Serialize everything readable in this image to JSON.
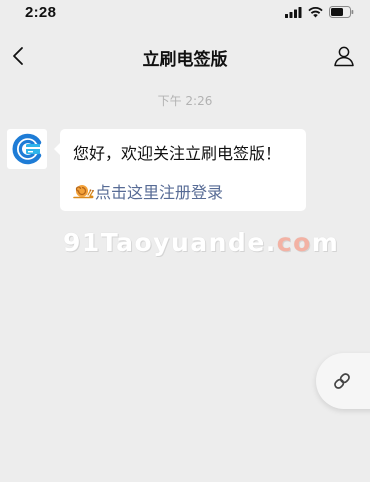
{
  "status_bar": {
    "time": "2:28",
    "icons": [
      "signal-icon",
      "wifi-icon",
      "battery-icon"
    ]
  },
  "nav": {
    "title": "立刷电签版",
    "back_icon": "chevron-left-icon",
    "profile_icon": "person-icon"
  },
  "chat": {
    "timestamp": "下午 2:26",
    "message": {
      "greeting": "您好，欢迎关注立刷电签版！",
      "link_text": "点击这里注册登录",
      "link_icon": "snail-icon"
    }
  },
  "watermark": {
    "prefix": "91Taoyuande.",
    "accent": "co",
    "suffix": "m"
  },
  "fab": {
    "icon": "link-icon"
  },
  "colors": {
    "background": "#ededed",
    "link": "#576b95",
    "timestamp": "#b2b2b2",
    "bubble": "#ffffff"
  }
}
